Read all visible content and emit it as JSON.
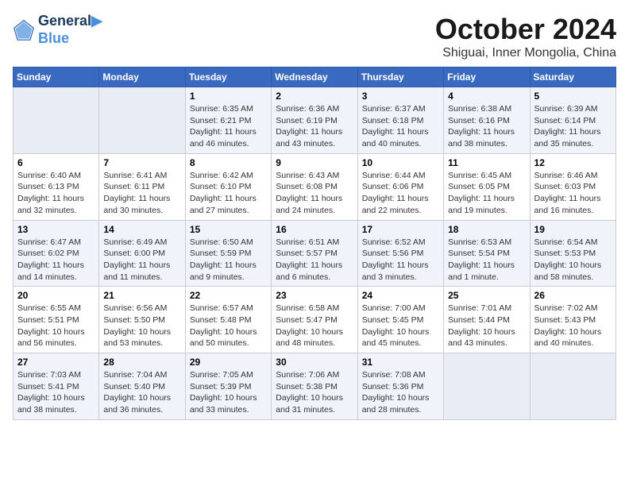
{
  "header": {
    "logo_line1": "General",
    "logo_line2": "Blue",
    "month": "October 2024",
    "location": "Shiguai, Inner Mongolia, China"
  },
  "weekdays": [
    "Sunday",
    "Monday",
    "Tuesday",
    "Wednesday",
    "Thursday",
    "Friday",
    "Saturday"
  ],
  "weeks": [
    [
      {
        "day": "",
        "detail": ""
      },
      {
        "day": "",
        "detail": ""
      },
      {
        "day": "1",
        "detail": "Sunrise: 6:35 AM\nSunset: 6:21 PM\nDaylight: 11 hours and 46 minutes."
      },
      {
        "day": "2",
        "detail": "Sunrise: 6:36 AM\nSunset: 6:19 PM\nDaylight: 11 hours and 43 minutes."
      },
      {
        "day": "3",
        "detail": "Sunrise: 6:37 AM\nSunset: 6:18 PM\nDaylight: 11 hours and 40 minutes."
      },
      {
        "day": "4",
        "detail": "Sunrise: 6:38 AM\nSunset: 6:16 PM\nDaylight: 11 hours and 38 minutes."
      },
      {
        "day": "5",
        "detail": "Sunrise: 6:39 AM\nSunset: 6:14 PM\nDaylight: 11 hours and 35 minutes."
      }
    ],
    [
      {
        "day": "6",
        "detail": "Sunrise: 6:40 AM\nSunset: 6:13 PM\nDaylight: 11 hours and 32 minutes."
      },
      {
        "day": "7",
        "detail": "Sunrise: 6:41 AM\nSunset: 6:11 PM\nDaylight: 11 hours and 30 minutes."
      },
      {
        "day": "8",
        "detail": "Sunrise: 6:42 AM\nSunset: 6:10 PM\nDaylight: 11 hours and 27 minutes."
      },
      {
        "day": "9",
        "detail": "Sunrise: 6:43 AM\nSunset: 6:08 PM\nDaylight: 11 hours and 24 minutes."
      },
      {
        "day": "10",
        "detail": "Sunrise: 6:44 AM\nSunset: 6:06 PM\nDaylight: 11 hours and 22 minutes."
      },
      {
        "day": "11",
        "detail": "Sunrise: 6:45 AM\nSunset: 6:05 PM\nDaylight: 11 hours and 19 minutes."
      },
      {
        "day": "12",
        "detail": "Sunrise: 6:46 AM\nSunset: 6:03 PM\nDaylight: 11 hours and 16 minutes."
      }
    ],
    [
      {
        "day": "13",
        "detail": "Sunrise: 6:47 AM\nSunset: 6:02 PM\nDaylight: 11 hours and 14 minutes."
      },
      {
        "day": "14",
        "detail": "Sunrise: 6:49 AM\nSunset: 6:00 PM\nDaylight: 11 hours and 11 minutes."
      },
      {
        "day": "15",
        "detail": "Sunrise: 6:50 AM\nSunset: 5:59 PM\nDaylight: 11 hours and 9 minutes."
      },
      {
        "day": "16",
        "detail": "Sunrise: 6:51 AM\nSunset: 5:57 PM\nDaylight: 11 hours and 6 minutes."
      },
      {
        "day": "17",
        "detail": "Sunrise: 6:52 AM\nSunset: 5:56 PM\nDaylight: 11 hours and 3 minutes."
      },
      {
        "day": "18",
        "detail": "Sunrise: 6:53 AM\nSunset: 5:54 PM\nDaylight: 11 hours and 1 minute."
      },
      {
        "day": "19",
        "detail": "Sunrise: 6:54 AM\nSunset: 5:53 PM\nDaylight: 10 hours and 58 minutes."
      }
    ],
    [
      {
        "day": "20",
        "detail": "Sunrise: 6:55 AM\nSunset: 5:51 PM\nDaylight: 10 hours and 56 minutes."
      },
      {
        "day": "21",
        "detail": "Sunrise: 6:56 AM\nSunset: 5:50 PM\nDaylight: 10 hours and 53 minutes."
      },
      {
        "day": "22",
        "detail": "Sunrise: 6:57 AM\nSunset: 5:48 PM\nDaylight: 10 hours and 50 minutes."
      },
      {
        "day": "23",
        "detail": "Sunrise: 6:58 AM\nSunset: 5:47 PM\nDaylight: 10 hours and 48 minutes."
      },
      {
        "day": "24",
        "detail": "Sunrise: 7:00 AM\nSunset: 5:45 PM\nDaylight: 10 hours and 45 minutes."
      },
      {
        "day": "25",
        "detail": "Sunrise: 7:01 AM\nSunset: 5:44 PM\nDaylight: 10 hours and 43 minutes."
      },
      {
        "day": "26",
        "detail": "Sunrise: 7:02 AM\nSunset: 5:43 PM\nDaylight: 10 hours and 40 minutes."
      }
    ],
    [
      {
        "day": "27",
        "detail": "Sunrise: 7:03 AM\nSunset: 5:41 PM\nDaylight: 10 hours and 38 minutes."
      },
      {
        "day": "28",
        "detail": "Sunrise: 7:04 AM\nSunset: 5:40 PM\nDaylight: 10 hours and 36 minutes."
      },
      {
        "day": "29",
        "detail": "Sunrise: 7:05 AM\nSunset: 5:39 PM\nDaylight: 10 hours and 33 minutes."
      },
      {
        "day": "30",
        "detail": "Sunrise: 7:06 AM\nSunset: 5:38 PM\nDaylight: 10 hours and 31 minutes."
      },
      {
        "day": "31",
        "detail": "Sunrise: 7:08 AM\nSunset: 5:36 PM\nDaylight: 10 hours and 28 minutes."
      },
      {
        "day": "",
        "detail": ""
      },
      {
        "day": "",
        "detail": ""
      }
    ]
  ]
}
